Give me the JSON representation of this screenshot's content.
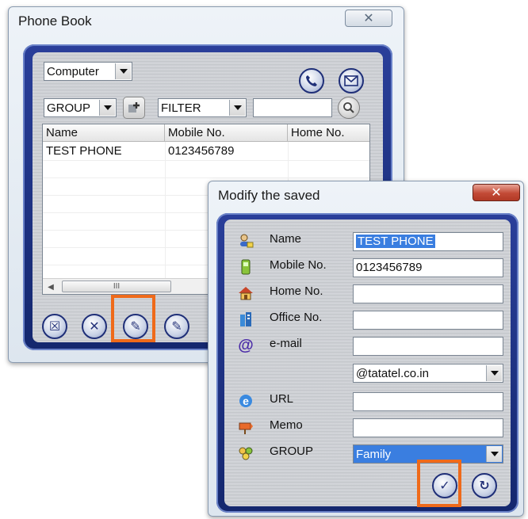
{
  "phonebook": {
    "title": "Phone Book",
    "close_glyph": "✕",
    "source_select": "Computer",
    "group_select": "GROUP",
    "filter_select": "FILTER",
    "filter_value": "",
    "columns": [
      "Name",
      "Mobile No.",
      "Home No."
    ],
    "rows": [
      {
        "name": "TEST PHONE",
        "mobile": "0123456789",
        "home": ""
      }
    ],
    "scroll_grip": "III",
    "buttons": {
      "delete_all": "☒",
      "delete": "✕",
      "modify": "✎",
      "edit": "✎"
    }
  },
  "modify": {
    "title": "Modify the saved",
    "close_glyph": "✕",
    "fields": [
      {
        "label": "Name",
        "value": "TEST PHONE"
      },
      {
        "label": "Mobile No.",
        "value": "0123456789"
      },
      {
        "label": "Home No.",
        "value": ""
      },
      {
        "label": "Office No.",
        "value": ""
      },
      {
        "label": "e-mail",
        "value": ""
      },
      {
        "label": "URL",
        "value": ""
      },
      {
        "label": "Memo",
        "value": ""
      },
      {
        "label": "GROUP",
        "value": "Family"
      }
    ],
    "email_domain": "@tatatel.co.in",
    "ok_glyph": "✓",
    "reset_glyph": "↻",
    "icons": [
      "person-icon",
      "mobile-phone-icon",
      "home-icon",
      "office-icon",
      "at-sign-icon",
      "internet-explorer-icon",
      "memo-icon",
      "group-icon"
    ]
  },
  "colors": {
    "frame_blue": "#14276e",
    "highlight_orange": "#ef6a1a",
    "selection_blue": "#3a7ee0"
  }
}
